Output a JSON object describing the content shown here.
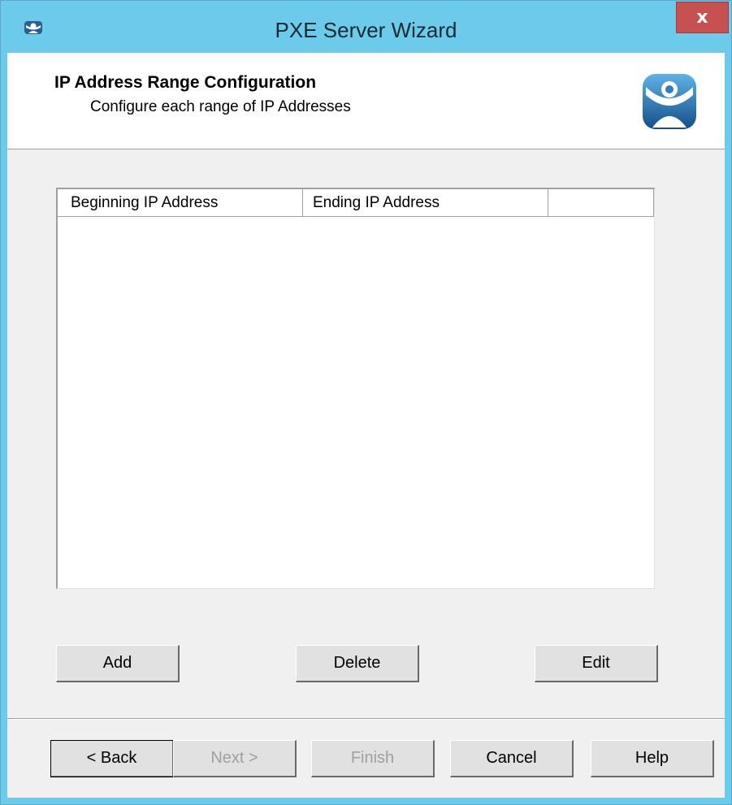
{
  "window": {
    "title": "PXE Server Wizard",
    "close_label": "x",
    "title_bar_color": "#6ccaeb"
  },
  "header": {
    "title": "IP Address Range Configuration",
    "subtitle": "Configure each range of IP Addresses",
    "logo_icon": "thinmanager-logo-icon",
    "logo_color": "#1f6aa8"
  },
  "listview": {
    "columns": [
      "Beginning IP Address",
      "Ending IP Address",
      ""
    ],
    "rows": []
  },
  "actions": {
    "add_label": "Add",
    "delete_label": "Delete",
    "edit_label": "Edit"
  },
  "navigation": {
    "back_label": "< Back",
    "next_label": "Next >",
    "finish_label": "Finish",
    "cancel_label": "Cancel",
    "help_label": "Help"
  }
}
